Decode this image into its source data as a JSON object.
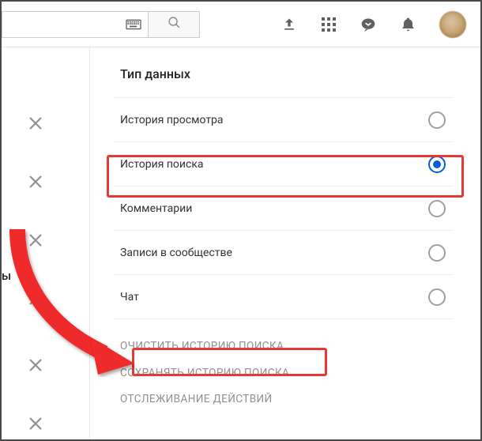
{
  "header": {
    "search_placeholder": "",
    "icons": {
      "keyboard": "keyboard-icon",
      "search": "search-icon",
      "upload": "upload-icon",
      "apps": "apps-icon",
      "messages": "messages-icon",
      "notifications": "bell-icon",
      "avatar": "avatar"
    }
  },
  "panel": {
    "title": "Тип данных",
    "options": [
      {
        "label": "История просмотра",
        "selected": false
      },
      {
        "label": "История поиска",
        "selected": true
      },
      {
        "label": "Комментарии",
        "selected": false
      },
      {
        "label": "Записи в сообществе",
        "selected": false
      },
      {
        "label": "Чат",
        "selected": false
      }
    ],
    "actions": [
      "ОЧИСТИТЬ ИСТОРИЮ ПОИСКА",
      "СОХРАНЯТЬ ИСТОРИЮ ПОИСКА",
      "ОТСЛЕЖИВАНИЕ ДЕЙСТВИЙ"
    ]
  },
  "left_truncated_char": "ы",
  "annotations": {
    "highlight_option_index": 1,
    "highlight_action_index": 0,
    "colors": {
      "highlight": "#e53935",
      "accent": "#065fd4"
    }
  }
}
